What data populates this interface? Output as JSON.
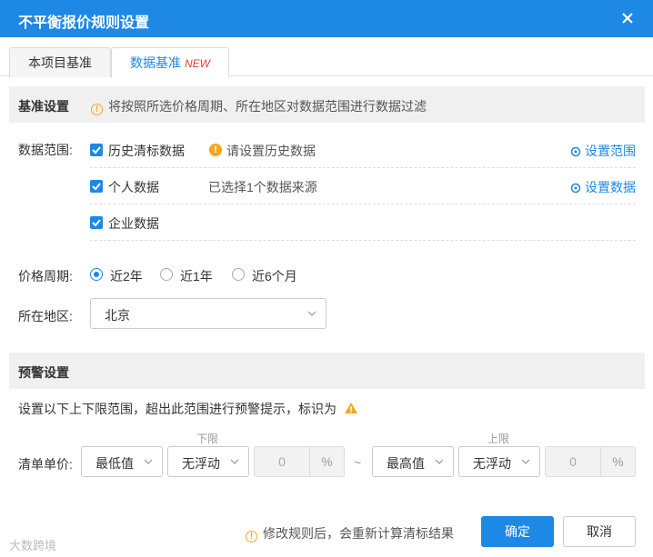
{
  "dialog": {
    "title": "不平衡报价规则设置"
  },
  "tabs": [
    {
      "label": "本项目基准",
      "active": false
    },
    {
      "label": "数据基准",
      "badge": "NEW",
      "active": true
    }
  ],
  "base_settings": {
    "title": "基准设置",
    "hint": "将按照所选价格周期、所在地区对数据范围进行数据过滤",
    "data_range_label": "数据范围:",
    "data_sources": [
      {
        "name": "历史清标数据",
        "checked": true,
        "info": "请设置历史数据",
        "info_warning": true,
        "action": "设置范围"
      },
      {
        "name": "个人数据",
        "checked": true,
        "info": "已选择1个数据来源",
        "info_warning": false,
        "action": "设置数据"
      },
      {
        "name": "企业数据",
        "checked": true,
        "info": "",
        "info_warning": false,
        "action": ""
      }
    ],
    "price_period_label": "价格周期:",
    "price_period_options": [
      "近2年",
      "近1年",
      "近6个月"
    ],
    "price_period_selected": "近2年",
    "region_label": "所在地区:",
    "region_value": "北京"
  },
  "warning_settings": {
    "title": "预警设置",
    "description": "设置以下上下限范围，超出此范围进行预警提示，标识为",
    "lower_label": "下限",
    "upper_label": "上限",
    "unit_price_label": "清单单价:",
    "lower": {
      "base": "最低值",
      "float": "无浮动",
      "value": "0",
      "unit": "%"
    },
    "separator": "~",
    "upper": {
      "base": "最高值",
      "float": "无浮动",
      "value": "0",
      "unit": "%"
    }
  },
  "footer": {
    "hint": "修改规则后，会重新计算清标结果",
    "confirm": "确定",
    "cancel": "取消"
  },
  "watermark": "大数跨境",
  "colors": {
    "primary": "#1e88e5",
    "warning": "#f5a623",
    "new_badge": "#e53935"
  }
}
